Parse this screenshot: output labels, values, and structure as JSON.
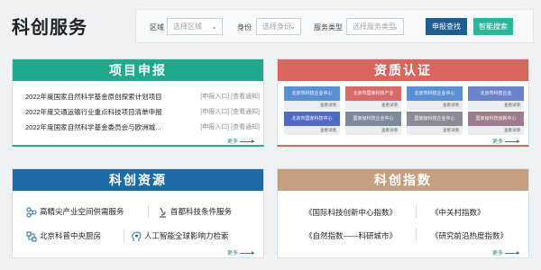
{
  "header": {
    "title": "科创服务"
  },
  "filters": {
    "region_label": "区域",
    "region_placeholder": "选择区域",
    "identity_label": "身份",
    "identity_placeholder": "选择身份",
    "service_label": "服务类型",
    "service_placeholder": "选择服务类型",
    "search_button": "申报查找",
    "smart_button": "智能搜索"
  },
  "project": {
    "title": "项目申报",
    "rows": [
      {
        "text": "2022年度国家自然科学基金原创探索计划项目",
        "tag": "[申报入口] [查看通知]"
      },
      {
        "text": "2022年度交通运输行业重点科技项目清单申报",
        "tag": "[申报入口] [查看通知]"
      },
      {
        "text": "2022年度国家自然科学基金委员会与欧洲城...",
        "tag": "[申报入口] [查看通知]"
      }
    ],
    "more": "更多"
  },
  "qualification": {
    "title": "资质认证",
    "items": [
      {
        "label": "北京市科技企业中心",
        "footer": "查看详情",
        "color": "#5b8fd4"
      },
      {
        "label": "北京市国家科技产业",
        "footer": "查看详情",
        "color": "#d66a66"
      },
      {
        "label": "北京市科技企业中心",
        "footer": "查看详情",
        "color": "#5b8fd4"
      },
      {
        "label": "北京市科技企业",
        "footer": "查看详情",
        "color": "#6b82c9"
      },
      {
        "label": "北京市国家科技中心",
        "footer": "查看详情",
        "color": "#4f6bc2"
      },
      {
        "label": "国家级科技企业中心",
        "footer": "查看详情",
        "color": "#7d8a9c"
      },
      {
        "label": "国家级科技企业中心",
        "footer": "查看详情",
        "color": "#8c8a96"
      },
      {
        "label": "国家级科技创新中心",
        "footer": "查看详情",
        "color": "#9d7a8c"
      }
    ],
    "more": "更多"
  },
  "resources": {
    "title": "科创资源",
    "items": [
      {
        "label": "高精尖产业空间供需服务",
        "icon": "nodes-icon"
      },
      {
        "label": "首都科技条件服务",
        "icon": "microscope-icon"
      },
      {
        "label": "北京科普中央厨房",
        "icon": "kitchen-icon"
      },
      {
        "label": "人工智能全球影响力检索",
        "icon": "head-ai-icon"
      }
    ],
    "more": "更多"
  },
  "index": {
    "title": "科创指数",
    "items": [
      {
        "label": "《国际科技创新中心指数》"
      },
      {
        "label": "《中关村指数》"
      },
      {
        "label": "《自然指数——科研城市》"
      },
      {
        "label": "《研究前沿热度指数》"
      }
    ],
    "more": "更多"
  },
  "colors": {
    "project_head": "#1faa8f",
    "qual_head": "#d9665c",
    "res_head": "#1c6aa6",
    "idx_head": "#c4a07f",
    "btn_dark": "#1d5d92",
    "btn_green": "#2bb79a"
  }
}
